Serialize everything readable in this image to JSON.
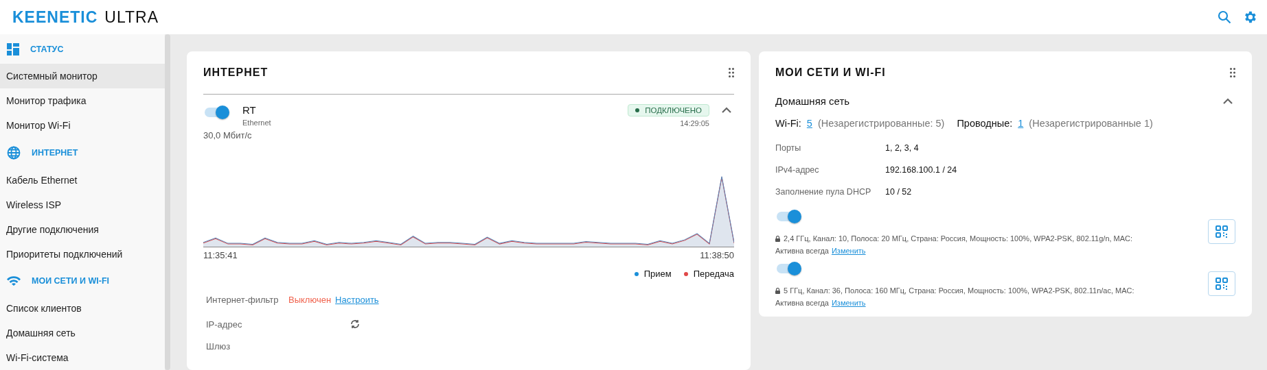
{
  "header": {
    "logo_brand": "KEENETIC",
    "logo_model": "ULTRA"
  },
  "sidebar": {
    "sections": [
      {
        "title": "СТАТУС",
        "kind": "dashboard",
        "items": [
          {
            "label": "Системный монитор",
            "selected": true
          },
          {
            "label": "Монитор трафика",
            "selected": false
          },
          {
            "label": "Монитор Wi-Fi",
            "selected": false
          }
        ]
      },
      {
        "title": "ИНТЕРНЕТ",
        "kind": "globe",
        "items": [
          {
            "label": "Кабель Ethernet",
            "selected": false
          },
          {
            "label": "Wireless ISP",
            "selected": false
          },
          {
            "label": "Другие подключения",
            "selected": false
          },
          {
            "label": "Приоритеты подключений",
            "selected": false
          }
        ]
      },
      {
        "title": "МОИ СЕТИ И WI-FI",
        "kind": "wifi",
        "items": [
          {
            "label": "Список клиентов",
            "selected": false
          },
          {
            "label": "Домашняя сеть",
            "selected": false
          },
          {
            "label": "Wi-Fi-система",
            "selected": false
          }
        ]
      }
    ]
  },
  "internet_card": {
    "title": "ИНТЕРНЕТ",
    "connection": {
      "name": "RT",
      "type": "Ethernet",
      "on": true,
      "expanded": true,
      "status": "ПОДКЛЮЧЕНО",
      "time": "14:29:05",
      "speed": "30,0 Мбит/с"
    },
    "chart": {
      "start": "11:35:41",
      "end": "11:38:50",
      "legend": [
        {
          "label": "Прием",
          "color": "#1a8fd9"
        },
        {
          "label": "Передача",
          "color": "#e04848"
        }
      ]
    },
    "rows": [
      {
        "label": "Интернет-фильтр",
        "value": "Выключен",
        "link": "Настроить"
      },
      {
        "label": "IP-адрес"
      },
      {
        "label": "Шлюз"
      }
    ]
  },
  "networks_card": {
    "title": "МОИ СЕТИ И WI-FI",
    "segment": {
      "name": "Домашняя сеть",
      "expanded": true,
      "wifi_label": "Wi-Fi:",
      "wifi_count": "5",
      "wifi_unreg": "(Незарегистрированные: 5)",
      "wired_label": "Проводные:",
      "wired_count": "1",
      "wired_unreg": "(Незарегистрированные 1)",
      "props": [
        {
          "label": "Порты",
          "value": "1, 2, 3, 4"
        },
        {
          "label": "IPv4-адрес",
          "value": "192.168.100.1 / 24"
        },
        {
          "label": "Заполнение пула DHCP",
          "value": "10 / 52"
        }
      ],
      "networks": [
        {
          "on": true,
          "details": "2,4 ГГц,  Канал: 10,  Полоса: 20 МГц,  Страна: Россия,  Мощность: 100%,  WPA2-PSK,  802.11g/n,  MAC:",
          "schedule": "Активна всегда",
          "link": "Изменить"
        },
        {
          "on": true,
          "details": "5 ГГц,  Канал: 36,  Полоса: 160 МГц,  Страна: Россия,  Мощность: 100%,  WPA2-PSK,  802.11n/ac,  MAC:",
          "schedule": "Активна всегда",
          "link": "Изменить"
        }
      ]
    }
  }
}
